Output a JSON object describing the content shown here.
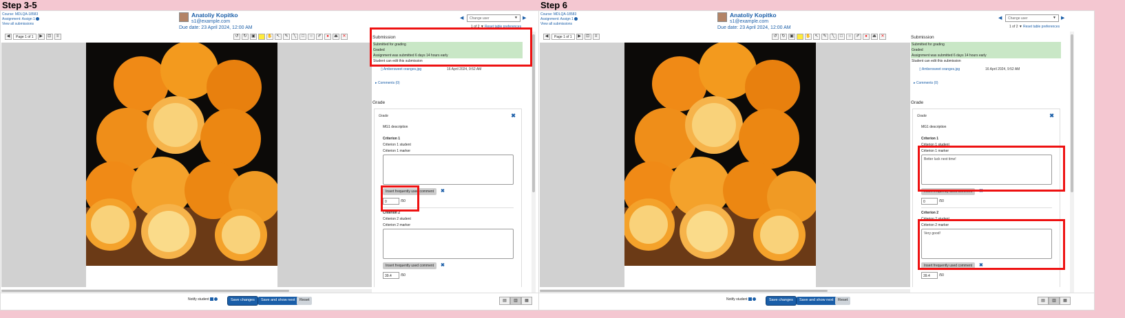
{
  "panels": [
    {
      "step_title": "Step 3-5",
      "course": {
        "line1": "Course: MDLQA-18583",
        "line2": "Assignment: Assign 1",
        "line3": "View all submissions"
      },
      "user": {
        "name": "Anatoliy Kopitko",
        "email": "s1@example.com",
        "due": "Due date: 23 April 2024, 12:00 AM"
      },
      "nav": {
        "change_user": "Change user",
        "of": "1 of 2",
        "reset": "Reset table preferences"
      },
      "toolbar": {
        "page": "Page 1 of 1"
      },
      "submission": {
        "heading": "Submission",
        "status1": "Submitted for grading",
        "status2": "Graded",
        "status3": "Assignment was submitted 6 days 14 hours early",
        "status4": "Student can edit this submission",
        "file": "Ambersweet oranges.jpg",
        "file_date": "16 April 2024, 9:52 AM",
        "comments": "Comments (0)"
      },
      "grade": {
        "heading": "Grade",
        "box_title": "Grade",
        "guide_desc": "MG1 description",
        "c1": "Criterion 1",
        "c1s": "Criterion 1 student",
        "c1m": "Criterion 1 marker",
        "c1text": "",
        "insert": "Insert frequently used comment",
        "score1": "0",
        "out_of": "/50",
        "c2": "Criterion 2",
        "c2s": "Criterion 2 student",
        "c2m": "Criterion 2 marker",
        "c2text": "",
        "score2": "39.4"
      },
      "footer": {
        "notify": "Notify student",
        "save": "Save changes",
        "save_next": "Save and show next",
        "reset": "Reset"
      }
    },
    {
      "step_title": "Step 6",
      "course": {
        "line1": "Course: MDLQA-18583",
        "line2": "Assignment: Assign 1",
        "line3": "View all submissions"
      },
      "user": {
        "name": "Anatoliy Kopitko",
        "email": "s1@example.com",
        "due": "Due date: 23 April 2024, 12:00 AM"
      },
      "nav": {
        "change_user": "Change user",
        "of": "1 of 2",
        "reset": "Reset table preferences"
      },
      "toolbar": {
        "page": "Page 1 of 1"
      },
      "submission": {
        "heading": "Submission",
        "status1": "Submitted for grading",
        "status2": "Graded",
        "status3": "Assignment was submitted 6 days 14 hours early",
        "status4": "Student can edit this submission",
        "file": "Ambersweet oranges.jpg",
        "file_date": "16 April 2024, 9:52 AM",
        "comments": "Comments (0)"
      },
      "grade": {
        "heading": "Grade",
        "box_title": "Grade",
        "guide_desc": "MG1 description",
        "c1": "Criterion 1",
        "c1s": "Criterion 1 student",
        "c1m": "Criterion 1 marker",
        "c1text": "Better luck next time!",
        "insert": "Insert frequently used comment",
        "score1": "0",
        "out_of": "/50",
        "c2": "Criterion 2",
        "c2s": "Criterion 2 student",
        "c2m": "Criterion 2 marker",
        "c2text": "Very good!",
        "score2": "39.4"
      },
      "footer": {
        "notify": "Notify student",
        "save": "Save changes",
        "save_next": "Save and show next",
        "reset": "Reset"
      }
    }
  ],
  "colors": {
    "link": "#1a5ea8",
    "highlight": "#e11111",
    "success_bg": "#c9e7c6"
  }
}
